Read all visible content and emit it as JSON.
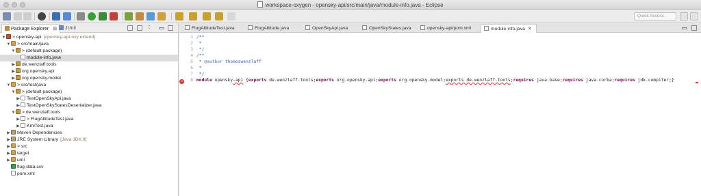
{
  "window": {
    "title": "workspace-oxygen - opensky-api/src/main/java/module-info.java - Eclipse"
  },
  "toolbar": {
    "quick_access_placeholder": "Quick Access"
  },
  "left_panel": {
    "tabs": [
      {
        "label": "Package Explorer",
        "close": "⊠"
      },
      {
        "label": "JUnit"
      }
    ],
    "tree": [
      {
        "depth": 0,
        "arrow": "▼",
        "icon": "project",
        "label": "> opensky-api",
        "deco": "[opensky-api-oxy extend]"
      },
      {
        "depth": 1,
        "arrow": "▼",
        "icon": "srcfolder",
        "label": "> src/main/java"
      },
      {
        "depth": 2,
        "arrow": "▼",
        "icon": "package",
        "label": "> (default package)"
      },
      {
        "depth": 3,
        "arrow": "",
        "icon": "java",
        "label": "module-info.java",
        "selected": true
      },
      {
        "depth": 2,
        "arrow": "▶",
        "icon": "package",
        "label": "de.wenzlaff.tools"
      },
      {
        "depth": 2,
        "arrow": "▶",
        "icon": "package",
        "label": "org.opensky.api"
      },
      {
        "depth": 2,
        "arrow": "▶",
        "icon": "package",
        "label": "org.opensky.model"
      },
      {
        "depth": 1,
        "arrow": "▼",
        "icon": "srcfolder",
        "label": "> src/test/java"
      },
      {
        "depth": 2,
        "arrow": "▼",
        "icon": "package",
        "label": "> (default package)"
      },
      {
        "depth": 3,
        "arrow": "▶",
        "icon": "java",
        "label": "TestOpenSkyApi.java"
      },
      {
        "depth": 3,
        "arrow": "▶",
        "icon": "java",
        "label": "TestOpenSkyStatesDeserializer.java"
      },
      {
        "depth": 2,
        "arrow": "▼",
        "icon": "package",
        "label": "> de.wenzlaff.tools"
      },
      {
        "depth": 3,
        "arrow": "▶",
        "icon": "java",
        "label": "> FlugAltitudeTest.java"
      },
      {
        "depth": 3,
        "arrow": "▶",
        "icon": "java",
        "label": "KmlTest.java"
      },
      {
        "depth": 1,
        "arrow": "▶",
        "icon": "lib",
        "label": "Maven Dependencies"
      },
      {
        "depth": 1,
        "arrow": "▶",
        "icon": "lib",
        "label": "JRE System Library",
        "deco": "[Java JDK 9]"
      },
      {
        "depth": 1,
        "arrow": "▶",
        "icon": "folder",
        "label": "> src"
      },
      {
        "depth": 1,
        "arrow": "▶",
        "icon": "folder",
        "label": "target"
      },
      {
        "depth": 1,
        "arrow": "▶",
        "icon": "folder",
        "label": "uml"
      },
      {
        "depth": 1,
        "arrow": "",
        "icon": "csv",
        "label": "flug-data.csv"
      },
      {
        "depth": 1,
        "arrow": "",
        "icon": "xml",
        "label": "pom.xml"
      }
    ]
  },
  "editor": {
    "tabs": [
      {
        "label": "FlugAltitudeTest.java",
        "active": false
      },
      {
        "label": "FlugAltitude.java",
        "active": false
      },
      {
        "label": "OpenSkyApi.java",
        "active": false
      },
      {
        "label": "OpenSkyStates.java",
        "active": false
      },
      {
        "label": "opensky-api/pom.xml",
        "active": false
      },
      {
        "label": "module-info.java",
        "active": true,
        "close": "✕"
      }
    ],
    "lines": [
      {
        "num": "1",
        "text": "/**",
        "kind": "jd"
      },
      {
        "num": "2",
        "text": " *",
        "kind": "jd"
      },
      {
        "num": "3",
        "text": " */",
        "kind": "jd"
      },
      {
        "num": "4",
        "text": "/**",
        "kind": "jd"
      },
      {
        "num": "5",
        "text": " * @author thomoswenzlaff",
        "kind": "jd"
      },
      {
        "num": "6",
        "text": " *",
        "kind": "jd"
      },
      {
        "num": "7",
        "text": " */",
        "kind": "jd"
      },
      {
        "num": "8",
        "text": "module opensky-api {exports de.wenzlaff.tools;exports org.opensky.api;exports org.opensky.model;exports de.wenzlaff.tools;requires java.base;requires java.corba;requires jdk.compiler;}",
        "kind": "code",
        "error": true
      }
    ],
    "line8_parts": [
      {
        "t": "module",
        "c": "kw"
      },
      {
        "t": " opensky",
        "c": ""
      },
      {
        "t": "-api",
        "c": "squig"
      },
      {
        "t": " {",
        "c": ""
      },
      {
        "t": "exports",
        "c": "kw"
      },
      {
        "t": " de.wenzlaff.tools;",
        "c": ""
      },
      {
        "t": "exports",
        "c": "kw"
      },
      {
        "t": " org.opensky.api;",
        "c": ""
      },
      {
        "t": "exports",
        "c": "kw"
      },
      {
        "t": " org.opensky.model;",
        "c": ""
      },
      {
        "t": "exports de.wenzlaff.tools",
        "c": "squig"
      },
      {
        "t": ";",
        "c": ""
      },
      {
        "t": "requires",
        "c": "kw"
      },
      {
        "t": " java.base;",
        "c": ""
      },
      {
        "t": "requires",
        "c": "kw"
      },
      {
        "t": " java.corba;",
        "c": ""
      },
      {
        "t": "requires",
        "c": "kw"
      },
      {
        "t": " jdk.compiler;}",
        "c": ""
      }
    ],
    "error_icon": "✕"
  },
  "colors": {
    "keyword": "#7f0055",
    "javadoc": "#3f5fbf",
    "error": "#dd3333",
    "selection": "#dcdcdc"
  }
}
